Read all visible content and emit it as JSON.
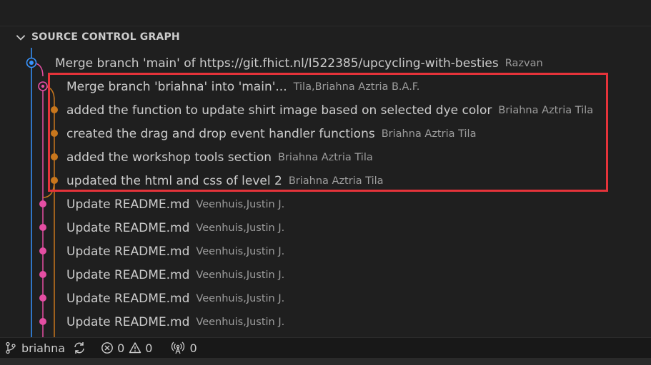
{
  "panel": {
    "title": "SOURCE CONTROL GRAPH",
    "icon": "chevron-down-icon"
  },
  "colors": {
    "lane_blue": "#3794ff",
    "lane_pink": "#e54ea3",
    "lane_orange": "#c8771d",
    "highlight": "#e5333a"
  },
  "commits": [
    {
      "message": "Merge branch 'main' of https://git.fhict.nl/I522385/upcycling-with-besties",
      "author": "Razvan",
      "lane": "blue",
      "kind": "head-merge"
    },
    {
      "message": "Merge branch 'briahna' into 'main'...",
      "author": "Tila,Briahna Aztria B.A.F.",
      "lane": "pink",
      "kind": "merge"
    },
    {
      "message": "added the function to update shirt image based on selected dye color",
      "author": "Briahna Aztria Tila",
      "lane": "orange",
      "kind": "commit"
    },
    {
      "message": "created the drag and drop event handler functions",
      "author": "Briahna Aztria Tila",
      "lane": "orange",
      "kind": "commit"
    },
    {
      "message": "added the workshop tools section",
      "author": "Briahna Aztria Tila",
      "lane": "orange",
      "kind": "commit"
    },
    {
      "message": "updated the html and css of level 2",
      "author": "Briahna Aztria Tila",
      "lane": "orange",
      "kind": "commit"
    },
    {
      "message": "Update README.md",
      "author": "Veenhuis,Justin J.",
      "lane": "pink",
      "kind": "commit"
    },
    {
      "message": "Update README.md",
      "author": "Veenhuis,Justin J.",
      "lane": "pink",
      "kind": "commit"
    },
    {
      "message": "Update README.md",
      "author": "Veenhuis,Justin J.",
      "lane": "pink",
      "kind": "commit"
    },
    {
      "message": "Update README.md",
      "author": "Veenhuis,Justin J.",
      "lane": "pink",
      "kind": "commit"
    },
    {
      "message": "Update README.md",
      "author": "Veenhuis,Justin J.",
      "lane": "pink",
      "kind": "commit"
    },
    {
      "message": "Update README.md",
      "author": "Veenhuis,Justin J.",
      "lane": "pink",
      "kind": "commit"
    }
  ],
  "status_bar": {
    "branch_icon": "git-branch-icon",
    "branch": "briahna",
    "sync_icon": "sync-icon",
    "errors_icon": "error-icon",
    "errors": "0",
    "warnings_icon": "warning-icon",
    "warnings": "0",
    "ports_icon": "broadcast-icon",
    "ports": "0"
  }
}
